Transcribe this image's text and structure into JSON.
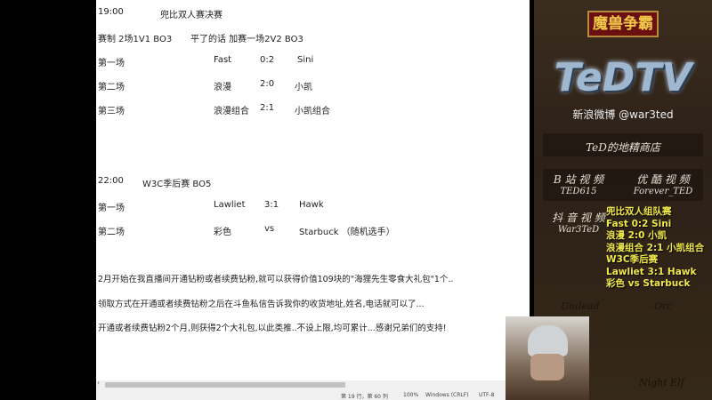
{
  "editor": {
    "lines": [
      {
        "cols": [
          "19:00",
          "兜比双人赛决赛"
        ]
      },
      {
        "cols": [
          "赛制 2场1V1 BO3",
          "平了的话 加赛一场2V2 BO3"
        ]
      },
      {
        "cols": [
          "第一场",
          "Fast",
          "0:2",
          "Sini"
        ]
      },
      {
        "cols": [
          "第二场",
          "浪漫",
          "2:0",
          "小凯"
        ]
      },
      {
        "cols": [
          "第三场",
          "浪漫组合",
          "2:1",
          "小凯组合"
        ]
      },
      {
        "cols": [
          "22:00",
          "W3C季后赛 BO5"
        ]
      },
      {
        "cols": [
          "第一场",
          "Lawliet",
          "3:1",
          "Hawk"
        ]
      },
      {
        "cols": [
          "第二场",
          "彩色",
          "vs",
          "Starbuck （随机选手）"
        ]
      }
    ],
    "paragraphs": [
      "2月开始在我直播间开通钻粉或者续费钻粉,就可以获得价值109块的\"海狸先生零食大礼包\"1个..",
      "领取方式在开通或者续费钻粉之后在斗鱼私信告诉我你的收货地址,姓名,电话就可以了...",
      "开通或者续费钻粉2个月,则获得2个大礼包,以此类推..不设上限,均可累计...感谢兄弟们的支持!"
    ],
    "status": {
      "position": "第 19 行，第 60 列",
      "zoom": "100%",
      "eol": "Windows (CRLF)",
      "encoding": "UTF-8"
    }
  },
  "panel": {
    "game_logo": "魔兽争霸",
    "brand": "TeDTV",
    "weibo": "新浪微博 @war3ted",
    "shop": "TeD的地精商店",
    "bilibili_label": "B 站 视 频",
    "bilibili_id": "TED615",
    "youku_label": "优 酷 视 频",
    "youku_id": "Forever_TED",
    "douyin_label": "抖 音 视 频",
    "douyin_id": "War3TeD",
    "races": [
      "Undead",
      "Orc",
      "Night Elf"
    ]
  },
  "overlay": [
    "兜比双人组队赛",
    "Fast 0:2 Sini",
    "浪漫 2:0 小凯",
    "浪漫组合 2:1 小凯组合",
    "W3C季后赛",
    "Lawliet 3:1 Hawk",
    "彩色 vs Starbuck"
  ]
}
